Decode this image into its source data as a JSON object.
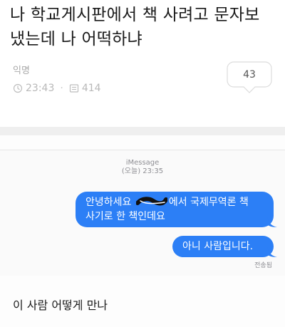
{
  "post": {
    "title": "나 학교게시판에서 책 사려고 문자보\n냈는데 나 어떡하냐",
    "author": "익명",
    "time": "23:43",
    "views": "414",
    "comment_count": "43",
    "icons": {
      "time": "clock-icon",
      "views": "views-icon",
      "comments": "speech-bubble-icon"
    }
  },
  "imessage": {
    "service": "iMessage",
    "timestamp": "(오늘) 23:35",
    "messages": [
      {
        "before_censor": "안녕하세요 ",
        "after_censor": "에서 국제무역론 책",
        "line2": "사기로 한 책인데요"
      },
      {
        "text": "아니 사람입니다."
      }
    ],
    "status": "전송됨",
    "bubble_color": "#2c7ff6"
  },
  "caption": "이 사람 어떻게 만나"
}
